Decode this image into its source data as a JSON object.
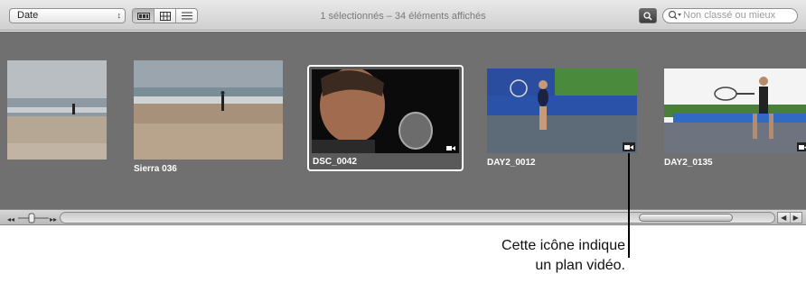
{
  "toolbar": {
    "sort_value": "Date",
    "status_text": "1 sélectionnés – 34 éléments affichés",
    "search_placeholder": "Non classé ou mieux"
  },
  "clips": [
    {
      "name": "",
      "selected": false,
      "video": false
    },
    {
      "name": "Sierra 036",
      "selected": false,
      "video": false
    },
    {
      "name": "DSC_0042",
      "selected": true,
      "video": true
    },
    {
      "name": "DAY2_0012",
      "selected": false,
      "video": true
    },
    {
      "name": "DAY2_0135",
      "selected": false,
      "video": true
    }
  ],
  "callout": {
    "line1": "Cette icône indique",
    "line2": "un plan vidéo."
  },
  "icons": {
    "view_modes": [
      "filmstrip-view-icon",
      "grid-view-icon",
      "list-view-icon"
    ],
    "video": "video-camera-icon",
    "search": "magnifier-icon"
  }
}
